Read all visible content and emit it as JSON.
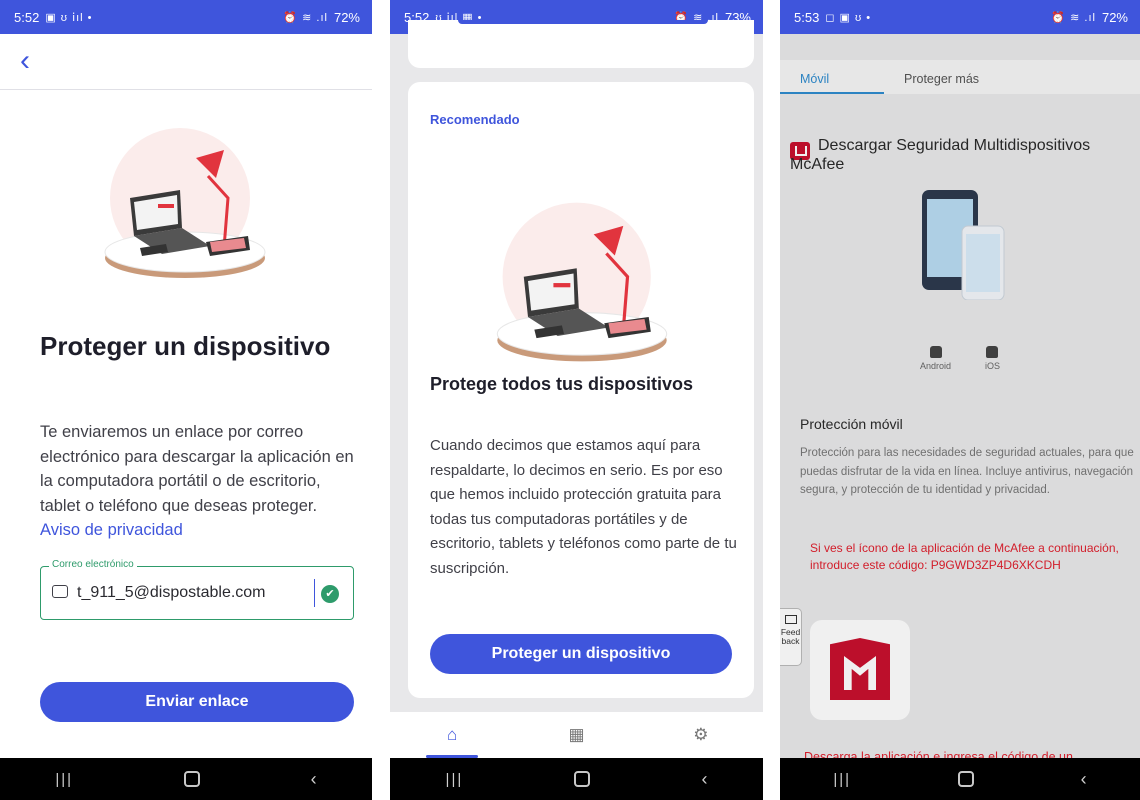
{
  "phone1": {
    "status": {
      "time": "5:52",
      "icons": "▣ ʊ ⅰıl •",
      "right": "⏰ ≋ .ıl",
      "battery": "72%"
    },
    "title": "Proteger un dispositivo",
    "body": "Te enviaremos un enlace por correo electrónico para descargar la aplicación en la computadora portátil o de escritorio, tablet o teléfono que deseas proteger.",
    "privacy_link": "Aviso de privacidad",
    "email_label": "Correo electrónico",
    "email_value": "t_911_5@dispostable.com",
    "send_button": "Enviar enlace"
  },
  "phone2": {
    "status": {
      "time": "5:52",
      "icons": "ʊ ⅰıl ▦ •",
      "right": "⏰ ≋ .ıl",
      "battery": "73%"
    },
    "recommended": "Recomendado",
    "title": "Protege todos tus dispositivos",
    "body": "Cuando decimos que estamos aquí para respaldarte, lo decimos en serio. Es por eso que hemos incluido protección gratuita para todas tus computadoras portátiles y de escritorio, tablets y teléfonos como parte de tu suscripción.",
    "protect_button": "Proteger un dispositivo"
  },
  "phone3": {
    "status": {
      "time": "5:53",
      "icons": "◻ ▣ ʊ •",
      "right": "⏰ ≋ .ıl",
      "battery": "72%"
    },
    "tabs": [
      "Móvil",
      "Proteger más"
    ],
    "download_title_line1": "Descargar Seguridad Multidispositivos",
    "download_title_line2": "McAfee",
    "os": [
      "Android",
      "iOS"
    ],
    "mobile_title": "Protección móvil",
    "mobile_body": "Protección para las necesidades de seguridad actuales, para que puedas disfrutar de la vida en línea. Incluye antivirus, navegación segura, y protección de tu identidad y privacidad.",
    "red_note": "Si ves el ícono de la aplicación de McAfee a continuación, introduce este código: P9GWD3ZP4D6XKCDH",
    "feedback": "Feed back",
    "bottom_text": "Descarga la aplicación e ingresa el código de un"
  },
  "navbar": {
    "recents": "|||",
    "back": "‹"
  },
  "colors": {
    "brand_blue": "#3f55dc",
    "success_green": "#2e9b6b",
    "mcafee_red": "#c8102e",
    "tab_blue": "#2f8ccf"
  }
}
